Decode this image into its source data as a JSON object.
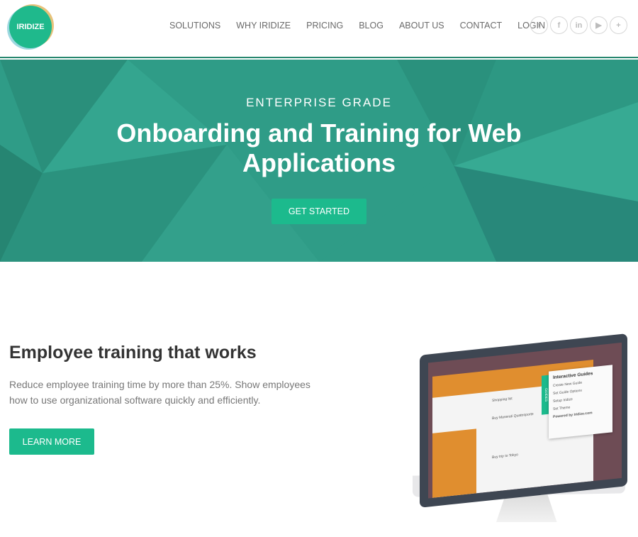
{
  "header": {
    "logo_text": "IRIDIZE",
    "nav": [
      "SOLUTIONS",
      "WHY IRIDIZE",
      "PRICING",
      "BLOG",
      "ABOUT US",
      "CONTACT",
      "LOGIN"
    ],
    "social": [
      {
        "icon": "twitter-icon",
        "glyph": "t"
      },
      {
        "icon": "facebook-icon",
        "glyph": "f"
      },
      {
        "icon": "linkedin-icon",
        "glyph": "in"
      },
      {
        "icon": "youtube-icon",
        "glyph": "▶"
      },
      {
        "icon": "plus-icon",
        "glyph": "+"
      }
    ]
  },
  "hero": {
    "kicker": "ENTERPRISE GRADE",
    "title": "Onboarding and Training for Web Applications",
    "cta": "GET STARTED",
    "bg_color": "#2f9c87"
  },
  "feature": {
    "title": "Employee training that works",
    "text": "Reduce employee training time by more than 25%. Show employees how to use organizational software quickly and efficiently.",
    "button": "LEARN MORE"
  },
  "illustration": {
    "tab": "GUIDES",
    "guides_title": "Interactive Guides",
    "guides": [
      "Create New Guide",
      "Set Guide Options",
      "Setup Iridize",
      "Set Theme"
    ],
    "powered": "Powered by Iridize.com",
    "list": [
      "Shopping list",
      "Buy Maserati Quattroporte",
      "Buy trip to Tokyo"
    ]
  },
  "colors": {
    "accent": "#1cba8d",
    "nav_text": "#6a6a6a"
  }
}
